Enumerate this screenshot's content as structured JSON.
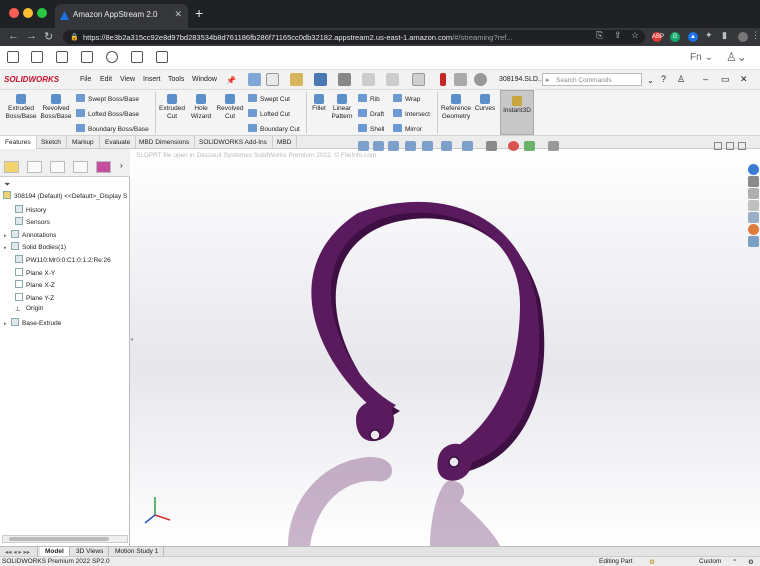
{
  "browser": {
    "tab_title": "Amazon AppStream 2.0",
    "url_host": "https://8e3b2a315cc92e8d97bd283534b8d761186fb286f71165cc0db32182.appstream2.us-east-1.amazon.com",
    "url_path": "/#/streaming?ref..."
  },
  "appstream": {
    "fn_label": "Fn"
  },
  "menubar": {
    "logo": "SOLIDWORKS",
    "items": [
      "File",
      "Edit",
      "View",
      "Insert",
      "Tools",
      "Window"
    ],
    "doc_name": "308194.SLD...",
    "search_placeholder": "Search Commands"
  },
  "ribbon": {
    "extruded_boss": "Extruded Boss/Base",
    "revolved_boss": "Revolved Boss/Base",
    "swept_boss": "Swept Boss/Base",
    "lofted_boss": "Lofted Boss/Base",
    "boundary_boss": "Boundary Boss/Base",
    "extruded_cut": "Extruded Cut",
    "hole_wizard": "Hole Wizard",
    "revolved_cut": "Revolved Cut",
    "swept_cut": "Swept Cut",
    "lofted_cut": "Lofted Cut",
    "boundary_cut": "Boundary Cut",
    "fillet": "Fillet",
    "linear_pattern": "Linear Pattern",
    "rib": "Rib",
    "draft": "Draft",
    "shell": "Shell",
    "wrap": "Wrap",
    "intersect": "Intersect",
    "mirror": "Mirror",
    "reference_geometry": "Reference Geometry",
    "curves": "Curves",
    "instant3d": "Instant3D"
  },
  "cm_tabs": [
    "Features",
    "Sketch",
    "Markup",
    "Evaluate",
    "MBD Dimensions",
    "SOLIDWORKS Add-Ins",
    "MBD"
  ],
  "tree": {
    "root": "308194 (Default) <<Default>_Display S",
    "items": [
      "History",
      "Sensors",
      "Annotations",
      "Solid Bodies(1)",
      "PW110:Mr0:0:C1:0:1:2:Re:26",
      "Plane X-Y",
      "Plane X-Z",
      "Plane Y-Z",
      "Origin",
      "Base-Extrude"
    ]
  },
  "viewport": {
    "message": "SLDPRT file open in Dassault Systemes SolidWorks Premium 2022. © FileInfo.com",
    "part_color": "#5a1a5e"
  },
  "bottom_tabs": [
    "Model",
    "3D Views",
    "Motion Study 1"
  ],
  "status": {
    "product": "SOLIDWORKS Premium 2022 SP2.0",
    "mode": "Editing Part",
    "units": "Custom"
  }
}
